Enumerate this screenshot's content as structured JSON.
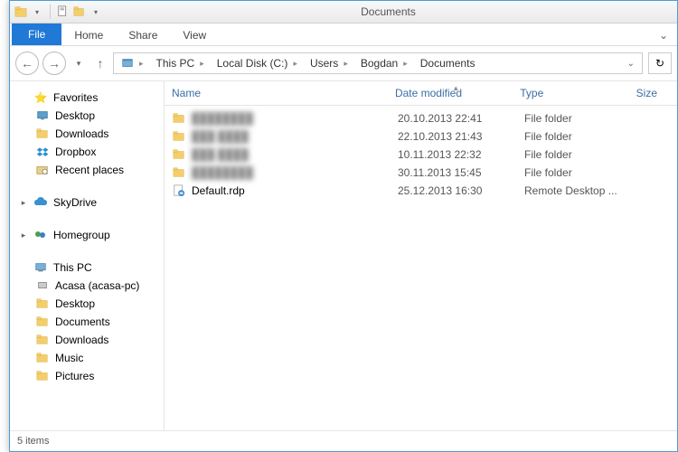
{
  "window": {
    "title": "Documents"
  },
  "ribbon": {
    "file": "File",
    "tabs": [
      "Home",
      "Share",
      "View"
    ]
  },
  "breadcrumbs": [
    {
      "label": "This PC"
    },
    {
      "label": "Local Disk (C:)"
    },
    {
      "label": "Users"
    },
    {
      "label": "Bogdan"
    },
    {
      "label": "Documents"
    }
  ],
  "sidebar": {
    "favorites": {
      "header": "Favorites",
      "items": [
        "Desktop",
        "Downloads",
        "Dropbox",
        "Recent places"
      ]
    },
    "skydrive": {
      "header": "SkyDrive"
    },
    "homegroup": {
      "header": "Homegroup"
    },
    "thispc": {
      "header": "This PC",
      "items": [
        "Acasa (acasa-pc)",
        "Desktop",
        "Documents",
        "Downloads",
        "Music",
        "Pictures"
      ]
    }
  },
  "columns": {
    "name": "Name",
    "date": "Date modified",
    "type": "Type",
    "size": "Size"
  },
  "files": [
    {
      "name": "████████",
      "blurred": true,
      "date": "20.10.2013 22:41",
      "type": "File folder",
      "icon": "folder"
    },
    {
      "name": "███ ████",
      "blurred": true,
      "date": "22.10.2013 21:43",
      "type": "File folder",
      "icon": "folder"
    },
    {
      "name": "███ ████",
      "blurred": true,
      "date": "10.11.2013 22:32",
      "type": "File folder",
      "icon": "folder"
    },
    {
      "name": "████████",
      "blurred": true,
      "date": "30.11.2013 15:45",
      "type": "File folder",
      "icon": "folder"
    },
    {
      "name": "Default.rdp",
      "blurred": false,
      "date": "25.12.2013 16:30",
      "type": "Remote Desktop ...",
      "icon": "rdp"
    }
  ],
  "status": {
    "count": "5 items"
  }
}
